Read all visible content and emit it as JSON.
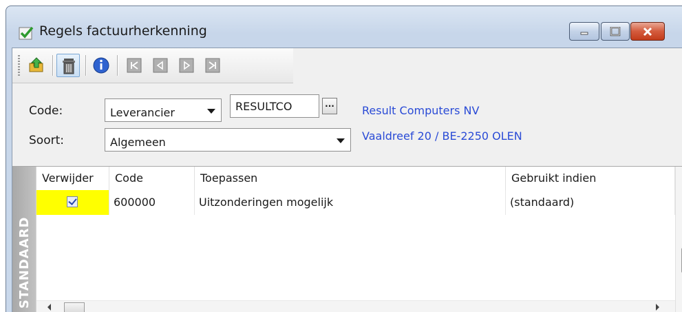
{
  "window": {
    "title": "Regels factuurherkenning",
    "controls": [
      "minimize",
      "maximize",
      "close"
    ]
  },
  "toolbar": {
    "buttons": [
      {
        "name": "export-icon"
      },
      {
        "name": "delete-icon",
        "pressed": true
      },
      {
        "name": "info-icon"
      },
      {
        "name": "first-record-icon"
      },
      {
        "name": "previous-record-icon"
      },
      {
        "name": "next-record-icon"
      },
      {
        "name": "last-record-icon"
      }
    ]
  },
  "filter": {
    "code_label": "Code:",
    "code_type": "Leverancier",
    "code_value": "RESULTCO",
    "browse_label": "...",
    "soort_label": "Soort:",
    "soort_value": "Algemeen",
    "supplier_name": "Result Computers NV",
    "supplier_address": "Vaaldreef 20 / BE-2250 OLEN"
  },
  "sidetab": {
    "label": "STANDAARD"
  },
  "grid": {
    "columns": [
      "Verwijder",
      "Code",
      "Toepassen",
      "Gebruikt indien"
    ],
    "rows": [
      {
        "verwijder": true,
        "code": "600000",
        "toepassen": "Uitzonderingen mogelijk",
        "gebruikt_indien": "(standaard)"
      }
    ]
  },
  "colors": {
    "highlight": "#ffff00",
    "link": "#2a4bd6",
    "close_button": "#c33c1b"
  }
}
